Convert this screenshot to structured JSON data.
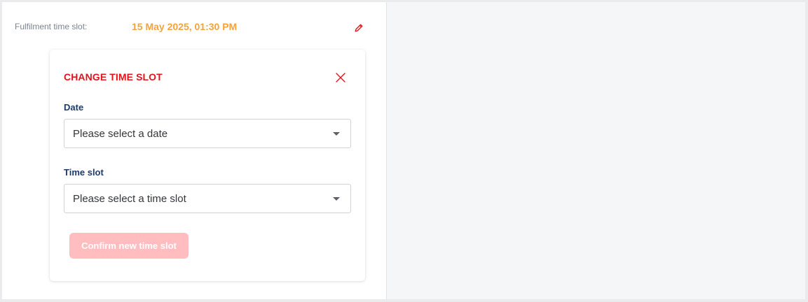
{
  "fulfilment": {
    "label": "Fulfilment time slot:",
    "value": "15 May 2025, 01:30 PM",
    "edit_icon": "pencil-icon"
  },
  "change_panel": {
    "title": "CHANGE TIME SLOT",
    "close_icon": "close-icon",
    "date": {
      "label": "Date",
      "placeholder": "Please select a date"
    },
    "time_slot": {
      "label": "Time slot",
      "placeholder": "Please select a time slot"
    },
    "confirm_label": "Confirm new time slot",
    "confirm_disabled": true
  },
  "colors": {
    "accent_red": "#e3131b",
    "slot_orange": "#f6a23a",
    "label_navy": "#1f3a6b",
    "button_disabled": "#ffbdc0"
  }
}
